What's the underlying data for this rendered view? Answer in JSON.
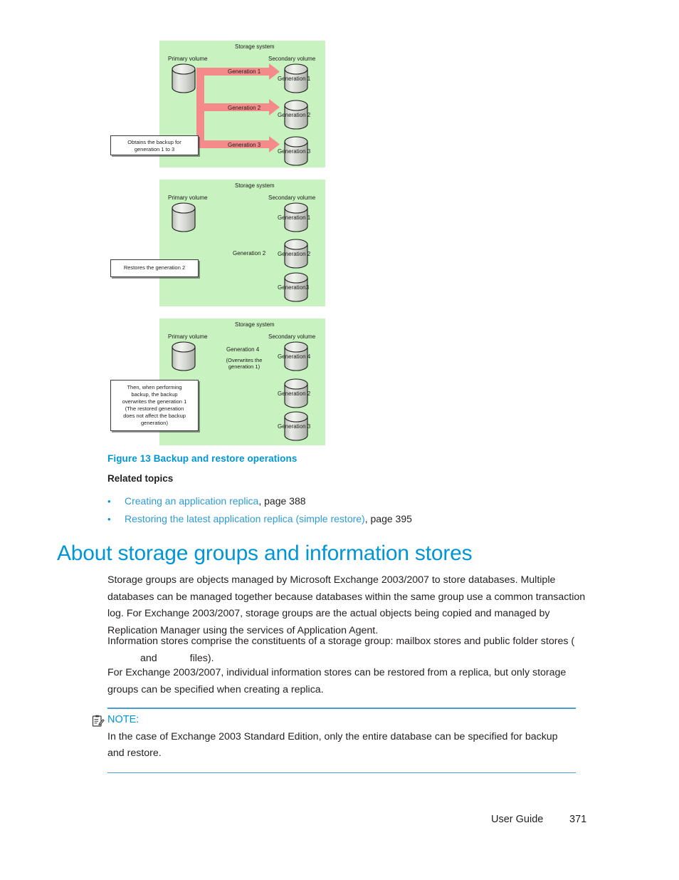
{
  "figure": {
    "caption": "Figure 13 Backup and restore operations",
    "panels": [
      {
        "id": "panel-backup",
        "storage_system_label": "Storage system",
        "primary_volume_label": "Primary volume",
        "secondary_volume_label": "Secondary volume",
        "callout": "Obtains the backup for\ngeneration 1 to 3",
        "arrow_labels": [
          "Generation 1",
          "Generation 2",
          "Generation 3"
        ],
        "cylinder_labels": [
          "Generation 1",
          "Generation 2",
          "Generation 3"
        ]
      },
      {
        "id": "panel-restore",
        "storage_system_label": "Storage system",
        "primary_volume_label": "Primary volume",
        "secondary_volume_label": "Secondary volume",
        "callout": "Restores the generation 2",
        "arrow_labels": [
          "Generation 2"
        ],
        "cylinder_labels": [
          "Generation 1",
          "Generation 2",
          "Generation3"
        ]
      },
      {
        "id": "panel-overwrite",
        "storage_system_label": "Storage system",
        "primary_volume_label": "Primary volume",
        "secondary_volume_label": "Secondary volume",
        "callout": "Then, when performing\nbackup, the backup\noverwrites the generation 1\n(The restored generation\ndoes not affect the backup\ngeneration)",
        "arrow_labels": [
          "Generation 4"
        ],
        "arrow_sublabel": "(Overwrites the\ngeneration 1)",
        "cylinder_labels": [
          "Generation 4",
          "Generation 2",
          "Generation 3"
        ]
      }
    ],
    "colors": {
      "panel_background": "#c8f2c0",
      "backup_arrow": "#f58a8a",
      "restore_arrow": "#f2e3c0",
      "cylinder_fill": "#d6d9d2",
      "cylinder_stroke": "#1a1a1a"
    }
  },
  "related": {
    "heading": "Related topics",
    "items": [
      {
        "bullet": "•",
        "link": "Creating an application replica",
        "page": ", page 388"
      },
      {
        "bullet": "•",
        "link": "Restoring the latest application replica (simple restore)",
        "page": ", page 395"
      }
    ]
  },
  "section": {
    "title": "About storage groups and information stores",
    "paragraphs": {
      "p1": "Storage groups are objects managed by Microsoft Exchange 2003/2007 to store databases. Multiple databases can be managed together because databases within the same group use a common transaction log. For Exchange 2003/2007, storage groups are the actual objects being copied and managed by Replication Manager using the services of Application Agent.",
      "p2_part1": "Information stores comprise the constituents of a storage group: mailbox stores and public folder stores (",
      "p2_part2": "and",
      "p2_part3": "files).",
      "p3": "For Exchange 2003/2007, individual information stores can be restored from a replica, but only storage groups can be specified when creating a replica."
    }
  },
  "note": {
    "icon": "note-clipboard-icon",
    "label": "NOTE:",
    "body": "In the case of Exchange 2003 Standard Edition, only the entire database can be specified for backup and restore."
  },
  "footer": {
    "guide_label": "User Guide",
    "page_number": "371"
  },
  "theme": {
    "accent": "#0096d6",
    "link": "#2e9bd6",
    "text": "#231f20",
    "rule": "#4a9ed4"
  }
}
